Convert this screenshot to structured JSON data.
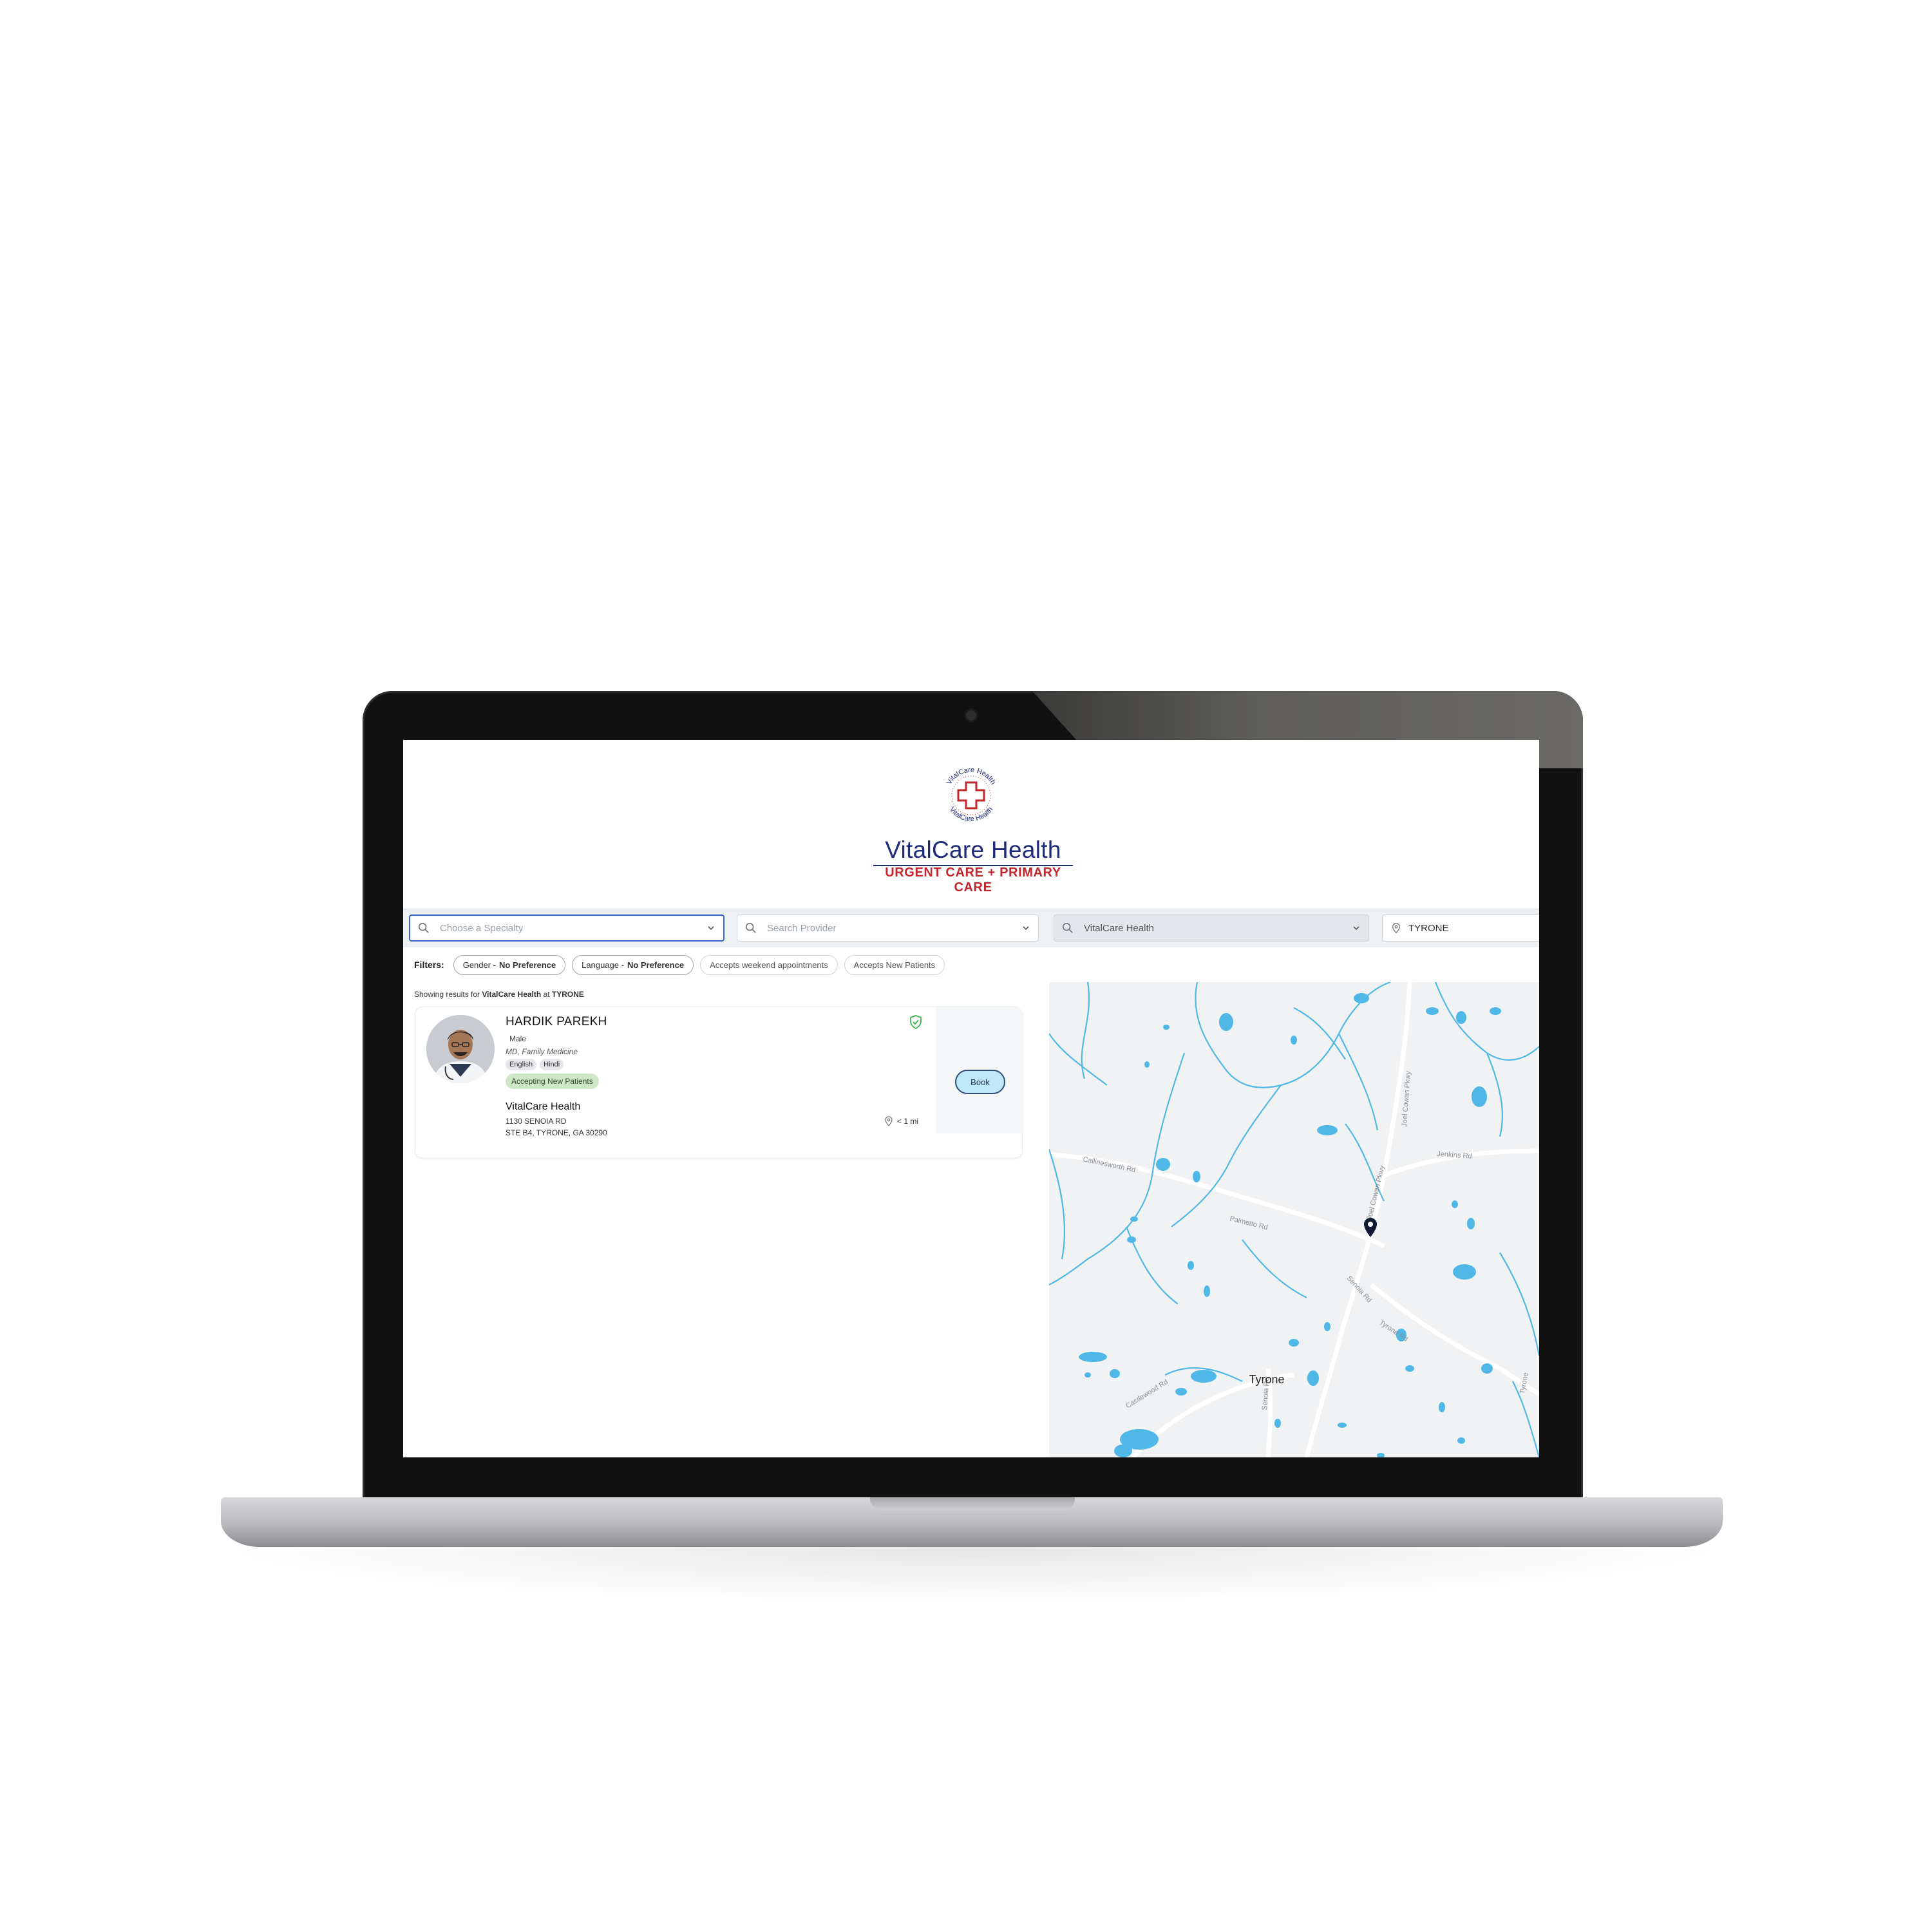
{
  "brand": {
    "seal_text": "VitalCare Health",
    "name": "VitalCare Health",
    "tagline": "URGENT CARE + PRIMARY CARE",
    "colors": {
      "navy": "#1e2a7a",
      "red": "#c1272d"
    }
  },
  "search": {
    "specialty_placeholder": "Choose a Specialty",
    "provider_placeholder": "Search Provider",
    "organization_value": "VitalCare Health",
    "location_value": "TYRONE"
  },
  "filters": {
    "label": "Filters:",
    "gender": {
      "name": "Gender -",
      "value": "No Preference"
    },
    "language": {
      "name": "Language -",
      "value": "No Preference"
    },
    "weekend": "Accepts weekend appointments",
    "new_patients": "Accepts New Patients"
  },
  "results": {
    "prefix": "Showing results for",
    "organization": "VitalCare Health",
    "connector": "at",
    "location": "TYRONE",
    "providers": [
      {
        "name": "HARDIK PAREKH",
        "gender": "Male",
        "credentials": "MD, Family Medicine",
        "languages": [
          "English",
          "Hindi"
        ],
        "status": "Accepting New Patients",
        "clinic": "VitalCare Health",
        "address_line1": "1130 SENOIA RD",
        "address_line2": "STE B4, TYRONE, GA 30290",
        "distance": "< 1 mi",
        "book_label": "Book",
        "verified_icon": "shield-check-icon"
      }
    ]
  },
  "map": {
    "town_label": "Tyrone",
    "road_labels": [
      "Callinesworth Rd",
      "Palmetto Rd",
      "Senoia Rd",
      "Tyrone Rd",
      "Jenkins Rd",
      "Castlewood Rd",
      "Senoia Rd",
      "Joel Cowan Pkwy",
      "Joel Cowan Pkwy",
      "Tyrone"
    ],
    "water_color": "#4fb8e6",
    "marker_icon": "map-pin-icon"
  }
}
